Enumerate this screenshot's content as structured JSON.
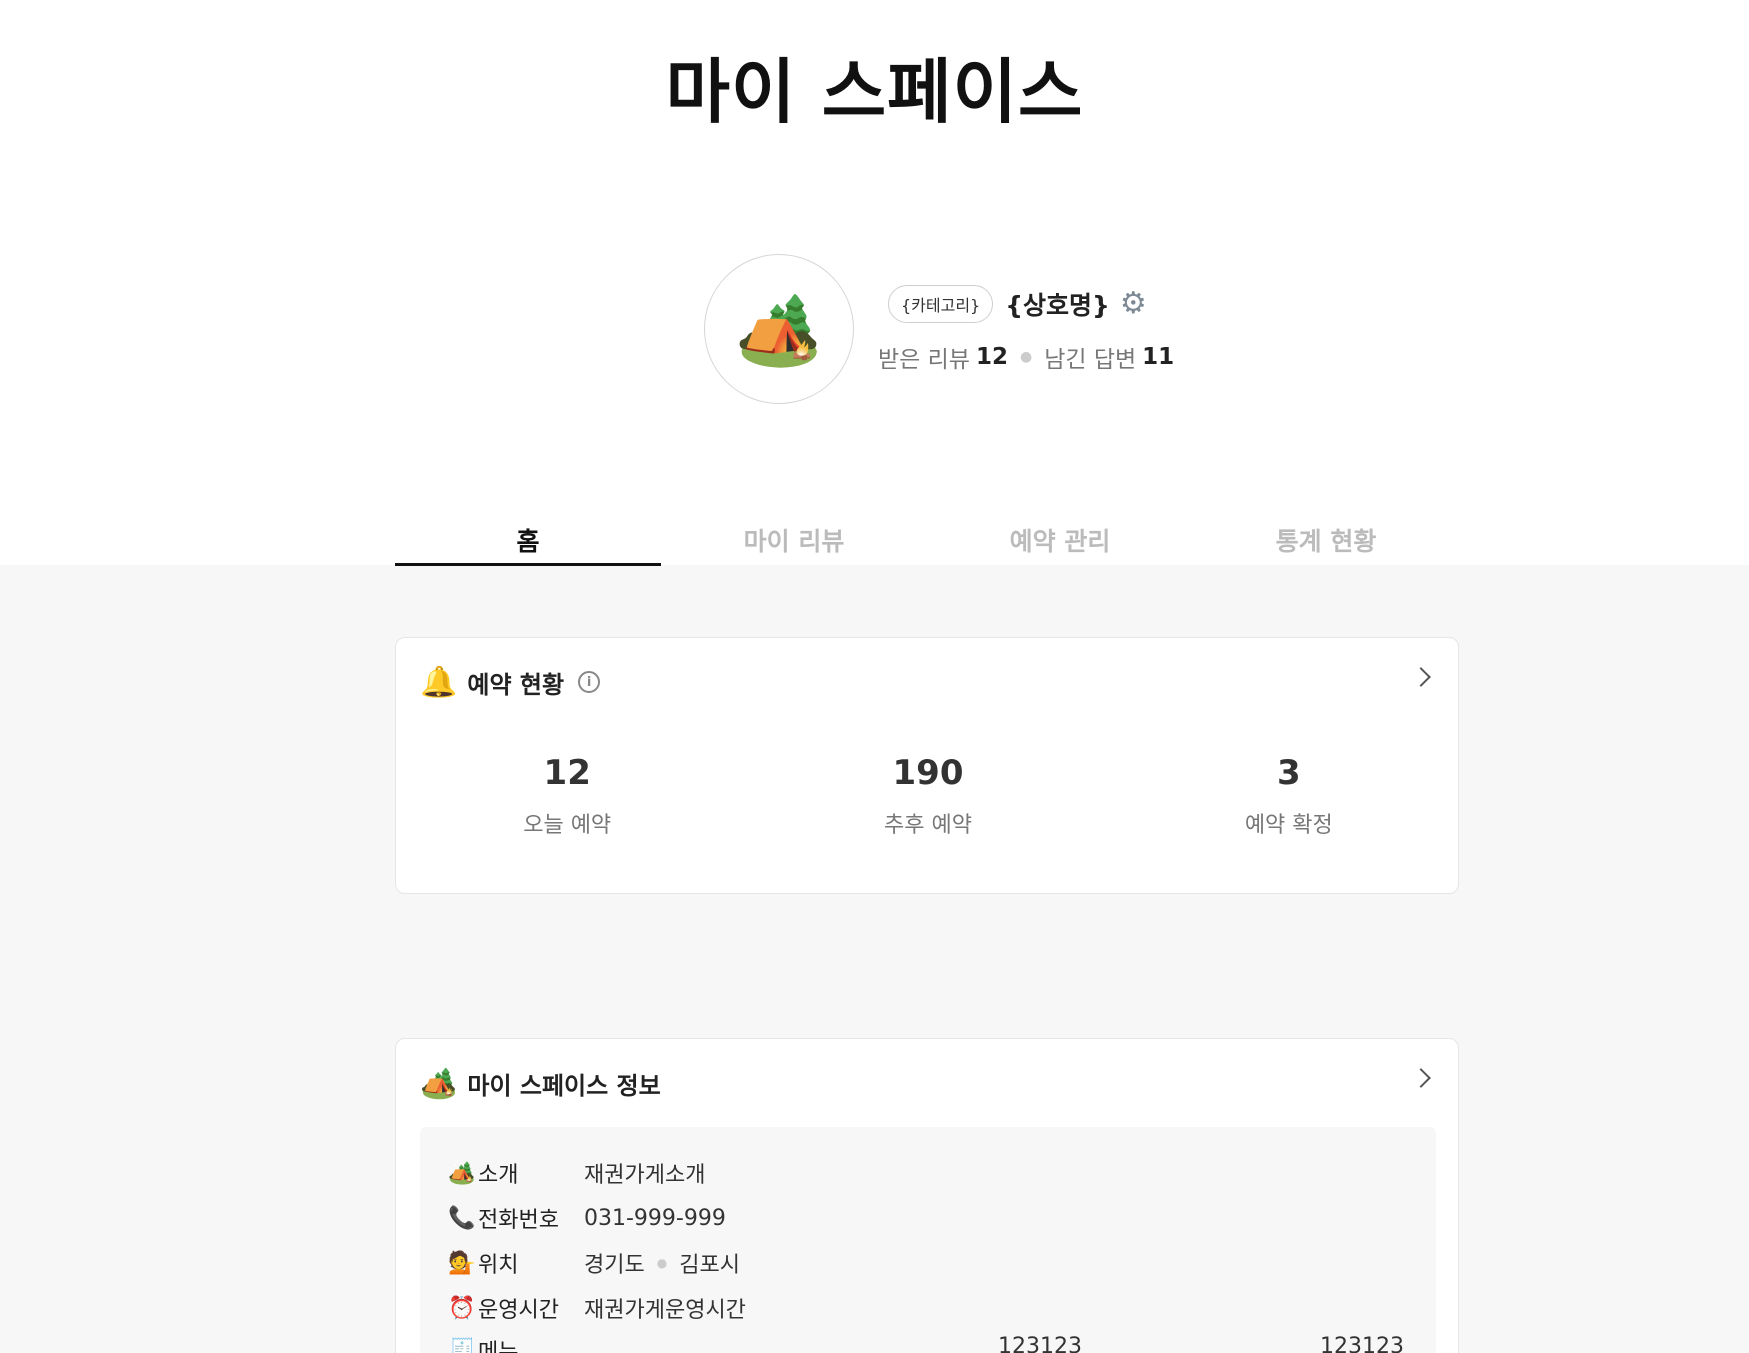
{
  "header": {
    "title": "마이 스페이스"
  },
  "profile": {
    "avatar_emoji": "🏕️",
    "category": "{카테고리}",
    "shop_name": "{상호명}",
    "settings_icon": "gear-icon",
    "received_reviews_label": "받은 리뷰",
    "received_reviews_count": "12",
    "left_replies_label": "남긴 답변",
    "left_replies_count": "11"
  },
  "tabs": [
    {
      "label": "홈",
      "active": true
    },
    {
      "label": "마이 리뷰",
      "active": false
    },
    {
      "label": "예약 관리",
      "active": false
    },
    {
      "label": "통계 현황",
      "active": false
    }
  ],
  "reservation": {
    "emoji": "🔔",
    "title": "예약 현황",
    "info_icon": "i",
    "stats": [
      {
        "value": "12",
        "label": "오늘 예약"
      },
      {
        "value": "190",
        "label": "추후 예약"
      },
      {
        "value": "3",
        "label": "예약 확정"
      }
    ]
  },
  "space_info": {
    "emoji": "🏕️",
    "title": "마이 스페이스 정보",
    "rows": [
      {
        "icon": "🏕️",
        "key": "소개",
        "value": "재권가게소개"
      },
      {
        "icon": "📞",
        "key": "전화번호",
        "value": "031-999-999"
      },
      {
        "icon": "💁",
        "key": "위치",
        "value": "경기도",
        "value2": "김포시"
      },
      {
        "icon": "⏰",
        "key": "운영시간",
        "value": "재권가게운영시간"
      },
      {
        "icon": "🧾",
        "key": "메뉴",
        "value": "123123",
        "value2": "123123"
      }
    ]
  },
  "colors": {
    "accent": "#111111",
    "inactive_tab": "#bbbbbb",
    "background_gray": "#f7f7f7"
  }
}
